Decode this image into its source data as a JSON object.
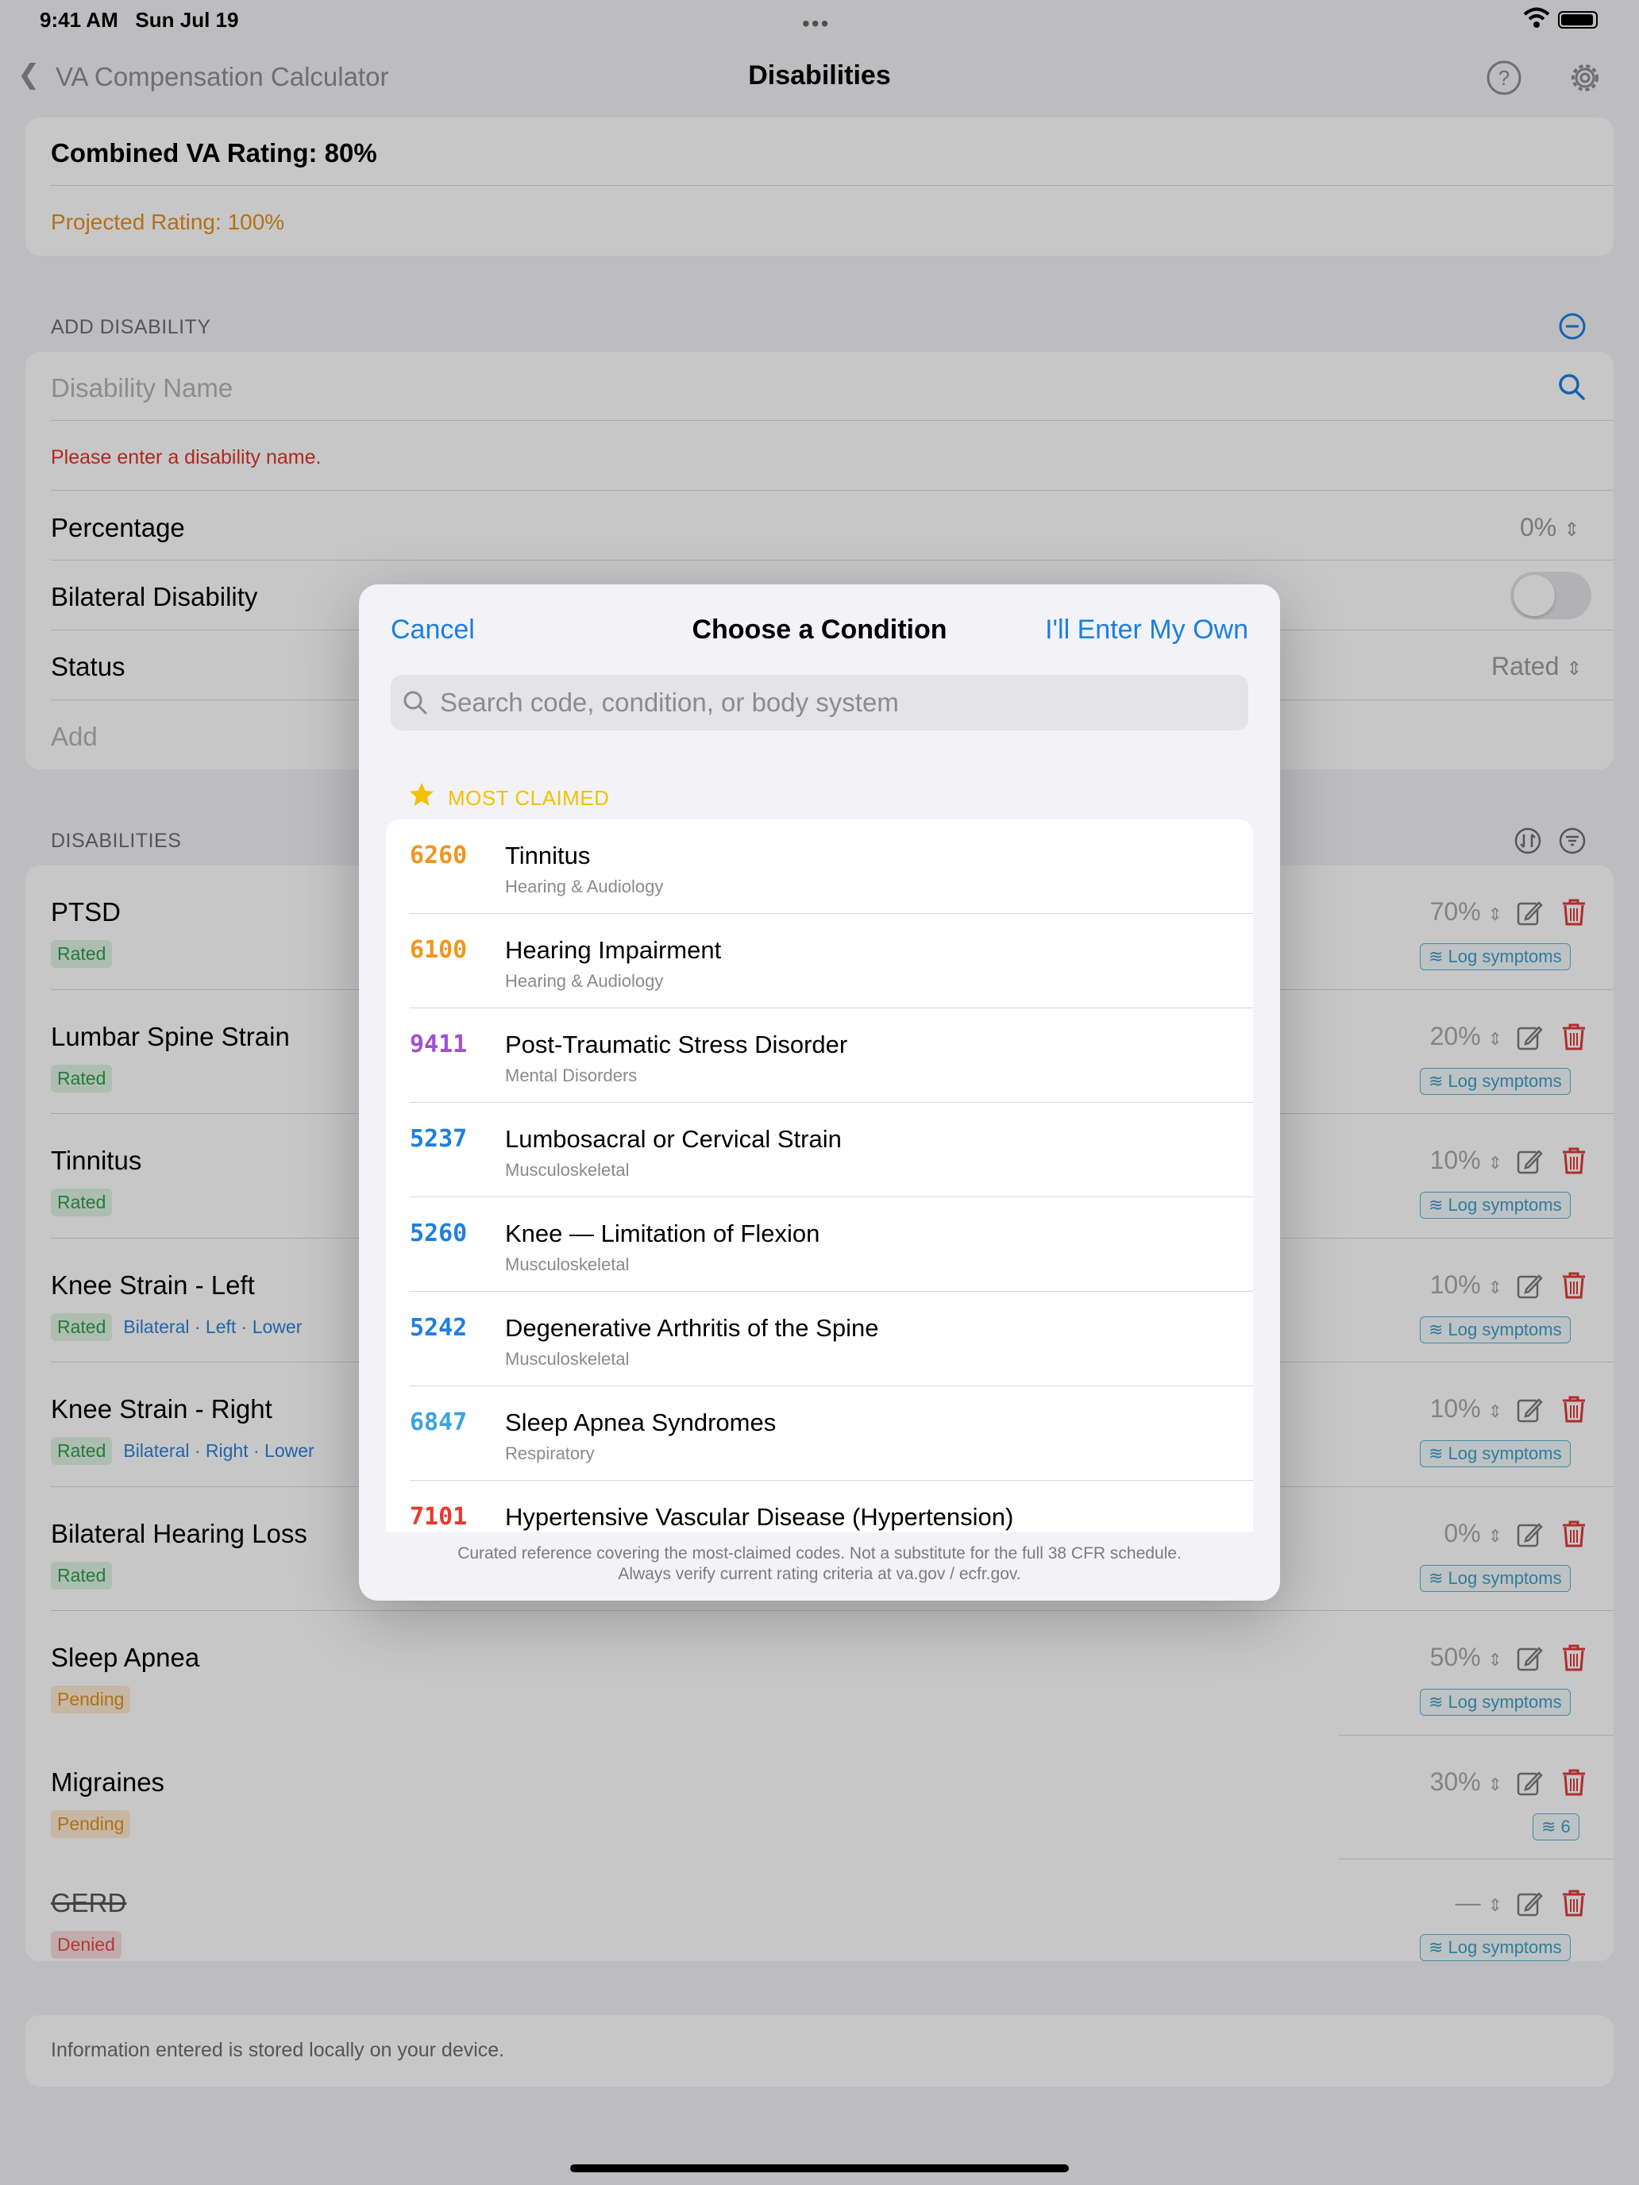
{
  "status_bar": {
    "time": "9:41 AM",
    "date": "Sun Jul 19",
    "dots": "•••"
  },
  "nav": {
    "back_label": "VA Compensation Calculator",
    "title": "Disabilities"
  },
  "summary": {
    "combined": "Combined VA Rating: 80%",
    "projected": "Projected Rating: 100%"
  },
  "add_disability": {
    "header": "ADD DISABILITY",
    "name_placeholder": "Disability Name",
    "error": "Please enter a disability name.",
    "percentage_label": "Percentage",
    "percentage_value": "0%",
    "bilateral_label": "Bilateral Disability",
    "status_label": "Status",
    "status_value": "Rated",
    "add_label": "Add"
  },
  "disabilities": {
    "header": "DISABILITIES",
    "log_label": "Log symptoms",
    "items": [
      {
        "name": "PTSD",
        "status": "Rated",
        "tags": "",
        "pct": "70%"
      },
      {
        "name": "Lumbar Spine Strain",
        "status": "Rated",
        "tags": "",
        "pct": "20%"
      },
      {
        "name": "Tinnitus",
        "status": "Rated",
        "tags": "",
        "pct": "10%"
      },
      {
        "name": "Knee Strain - Left",
        "status": "Rated",
        "tags": "Bilateral · Left · Lower",
        "pct": "10%"
      },
      {
        "name": "Knee Strain - Right",
        "status": "Rated",
        "tags": "Bilateral · Right · Lower",
        "pct": "10%"
      },
      {
        "name": "Bilateral Hearing Loss",
        "status": "Rated",
        "tags": "",
        "pct": "0%"
      },
      {
        "name": "Sleep Apnea",
        "status": "Pending",
        "tags": "",
        "pct": "50%"
      },
      {
        "name": "Migraines",
        "status": "Pending",
        "tags": "",
        "pct": "30%",
        "log_count": "6"
      },
      {
        "name": "GERD",
        "status": "Denied",
        "tags": "",
        "pct": "—"
      }
    ]
  },
  "footer_note": "Information entered is stored locally on your device.",
  "modal": {
    "cancel": "Cancel",
    "title": "Choose a Condition",
    "enter_own": "I'll Enter My Own",
    "search_placeholder": "Search code, condition, or body system",
    "section_label": "MOST CLAIMED",
    "conditions": [
      {
        "code": "6260",
        "name": "Tinnitus",
        "system": "Hearing & Audiology",
        "color": "#f0961e"
      },
      {
        "code": "6100",
        "name": "Hearing Impairment",
        "system": "Hearing & Audiology",
        "color": "#f0961e"
      },
      {
        "code": "9411",
        "name": "Post-Traumatic Stress Disorder",
        "system": "Mental Disorders",
        "color": "#a34ed6"
      },
      {
        "code": "5237",
        "name": "Lumbosacral or Cervical Strain",
        "system": "Musculoskeletal",
        "color": "#1f7fe0"
      },
      {
        "code": "5260",
        "name": "Knee — Limitation of Flexion",
        "system": "Musculoskeletal",
        "color": "#1f7fe0"
      },
      {
        "code": "5242",
        "name": "Degenerative Arthritis of the Spine",
        "system": "Musculoskeletal",
        "color": "#1f7fe0"
      },
      {
        "code": "6847",
        "name": "Sleep Apnea Syndromes",
        "system": "Respiratory",
        "color": "#3aa3e0"
      },
      {
        "code": "7101",
        "name": "Hypertensive Vascular Disease (Hypertension)",
        "system": "",
        "color": "#e8392e"
      }
    ],
    "footnote_line1": "Curated reference covering the most-claimed codes. Not a substitute for the full 38 CFR schedule.",
    "footnote_line2": "Always verify current rating criteria at va.gov / ecfr.gov."
  },
  "colors": {
    "accent": "#1a7fe3",
    "projected": "#e8901a",
    "error": "#e0332b",
    "delete": "#e03a3a"
  }
}
